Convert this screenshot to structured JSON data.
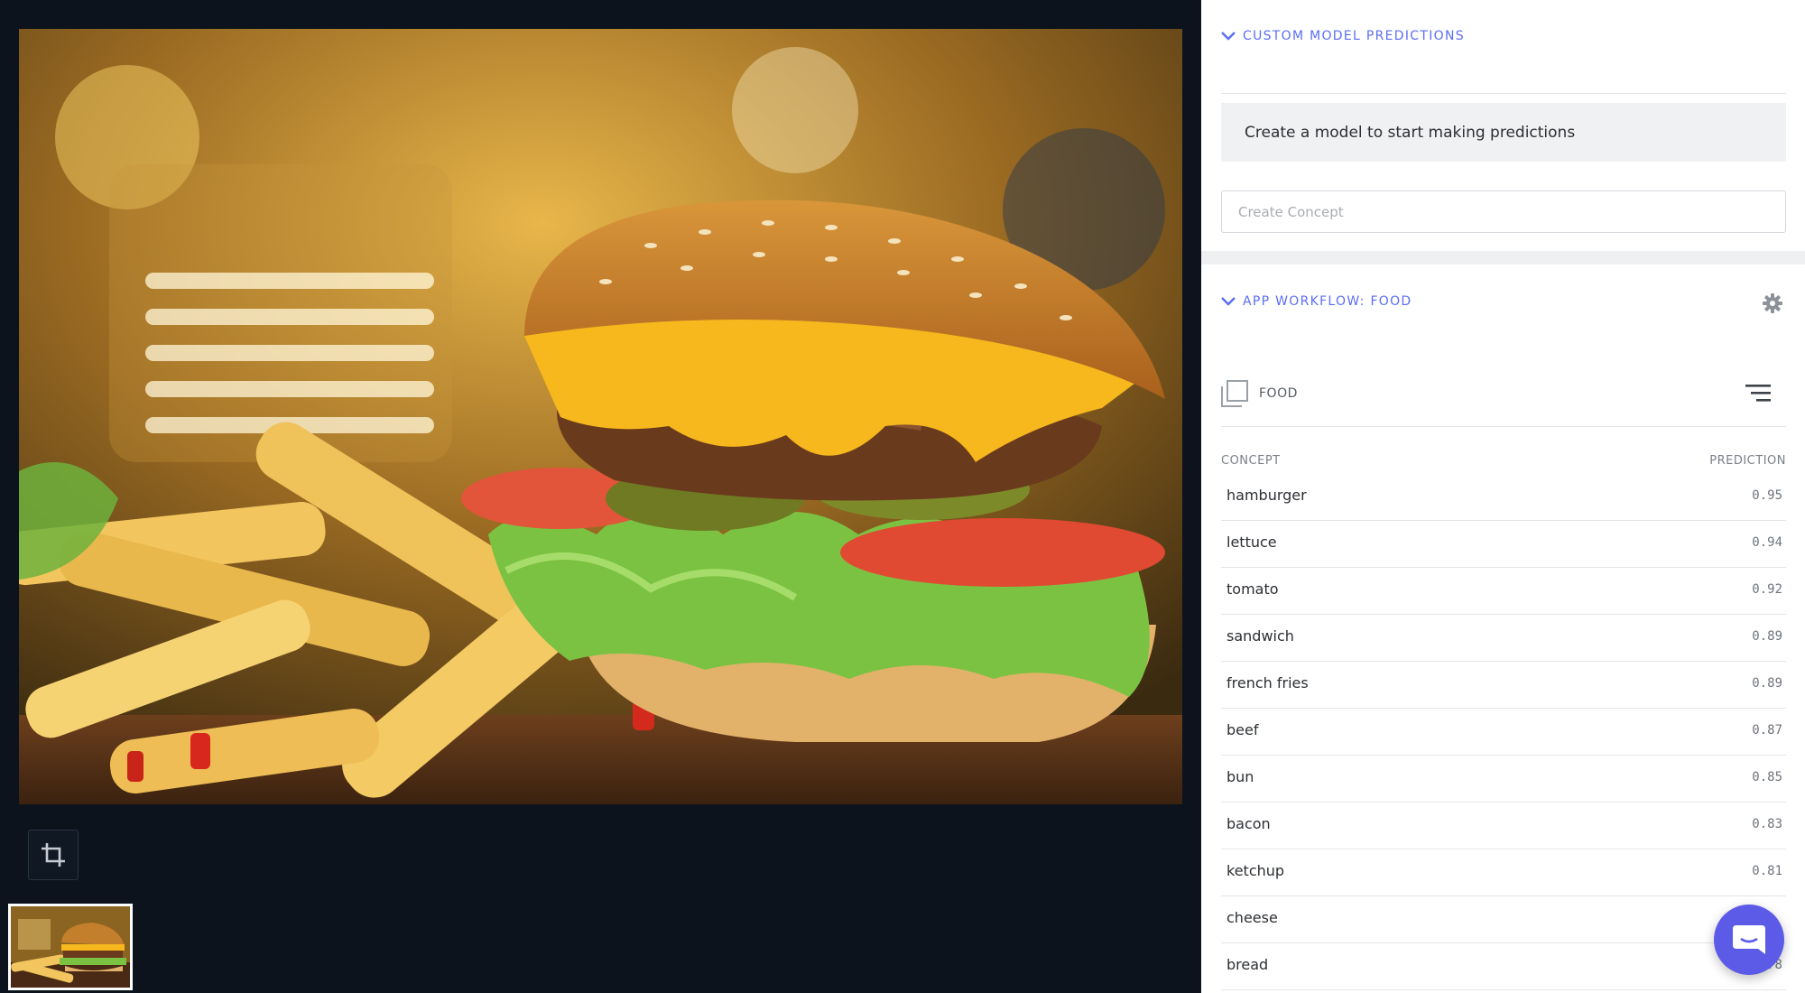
{
  "viewer": {
    "main_image_alt": "",
    "crop_icon": "crop-icon",
    "thumbnail_alt": ""
  },
  "custom_model": {
    "title": "CUSTOM MODEL PREDICTIONS",
    "empty_message": "Create a model to start making predictions",
    "input_placeholder": "Create Concept"
  },
  "workflow": {
    "title": "APP WORKFLOW: FOOD",
    "model_name": "FOOD",
    "columns": {
      "concept": "CONCEPT",
      "prediction": "PREDICTION"
    },
    "predictions": [
      {
        "concept": "hamburger",
        "value": "0.95"
      },
      {
        "concept": "lettuce",
        "value": "0.94"
      },
      {
        "concept": "tomato",
        "value": "0.92"
      },
      {
        "concept": "sandwich",
        "value": "0.89"
      },
      {
        "concept": "french fries",
        "value": "0.89"
      },
      {
        "concept": "beef",
        "value": "0.87"
      },
      {
        "concept": "bun",
        "value": "0.85"
      },
      {
        "concept": "bacon",
        "value": "0.83"
      },
      {
        "concept": "ketchup",
        "value": "0.81"
      },
      {
        "concept": "cheese",
        "value": ""
      },
      {
        "concept": "bread",
        "value": ".78"
      }
    ]
  },
  "colors": {
    "accent": "#5b6ef5",
    "viewer_bg": "#0c131d",
    "chat_button": "#5b5be8"
  }
}
